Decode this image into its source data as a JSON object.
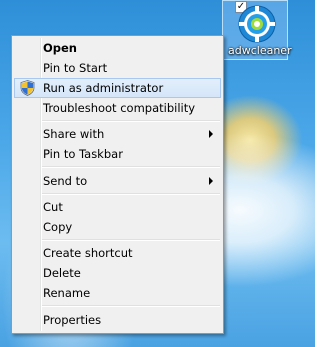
{
  "desktop_icon": {
    "caption": "adwcleaner",
    "checked_mark": "✓",
    "icon": "adwcleaner-app-icon"
  },
  "context_menu": {
    "items": [
      {
        "label": "Open"
      },
      {
        "label": "Pin to Start"
      },
      {
        "label": "Run as administrator",
        "icon": "uac-shield-icon"
      },
      {
        "label": "Troubleshoot compatibility"
      },
      {
        "label": "Share with",
        "submenu": true
      },
      {
        "label": "Pin to Taskbar"
      },
      {
        "label": "Send to",
        "submenu": true
      },
      {
        "label": "Cut"
      },
      {
        "label": "Copy"
      },
      {
        "label": "Create shortcut"
      },
      {
        "label": "Delete"
      },
      {
        "label": "Rename"
      },
      {
        "label": "Properties"
      }
    ]
  },
  "colors": {
    "menu_background": "#f0f0f0",
    "highlight_background": "#d5e6f9",
    "highlight_border": "#a8c8ef",
    "desktop_blue": "#4ba7e8"
  }
}
